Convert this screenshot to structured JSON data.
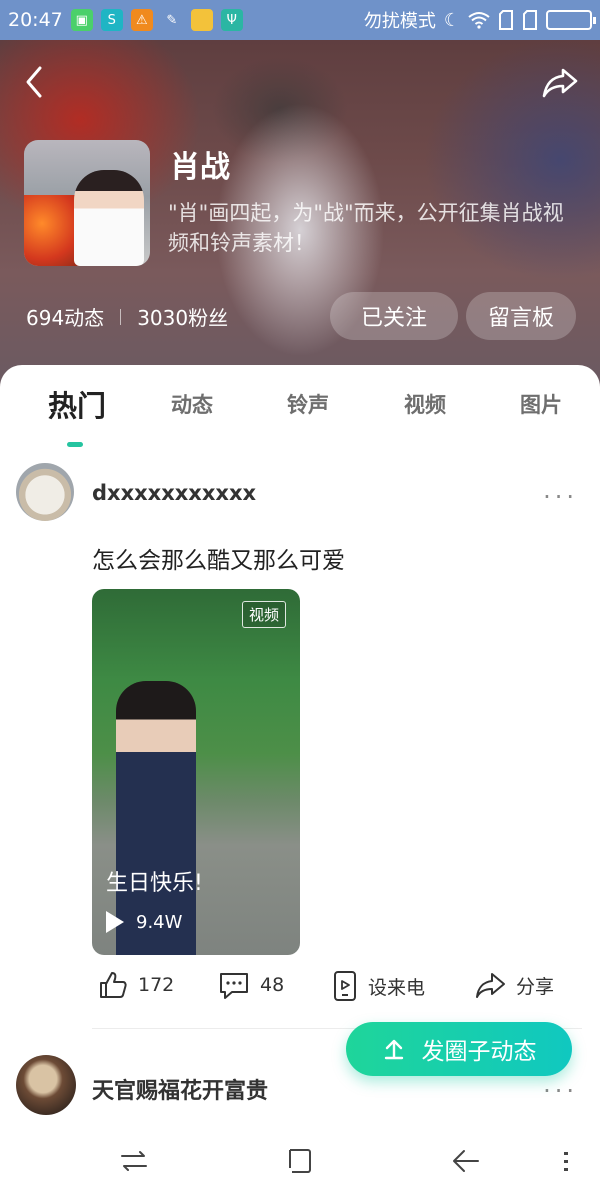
{
  "status_bar": {
    "time": "20:47",
    "dnd_label": "勿扰模式"
  },
  "profile": {
    "name": "肖战",
    "description": "\"肖\"画四起，为\"战\"而来，公开征集肖战视频和铃声素材！",
    "posts_count": "694动态",
    "fans_count": "3030粉丝",
    "follow_button": "已关注",
    "board_button": "留言板"
  },
  "tabs": [
    {
      "label": "热门",
      "active": true
    },
    {
      "label": "动态",
      "active": false
    },
    {
      "label": "铃声",
      "active": false
    },
    {
      "label": "视频",
      "active": false
    },
    {
      "label": "图片",
      "active": false
    }
  ],
  "post1": {
    "username": "dxxxxxxxxxxx",
    "text": "怎么会那么酷又那么可爱",
    "video": {
      "badge": "视频",
      "caption": "生日快乐!",
      "plays": "9.4W"
    },
    "actions": {
      "likes": "172",
      "comments": "48",
      "ringtone": "设来电",
      "share": "分享"
    }
  },
  "post2": {
    "username": "天官赐福花开富贵"
  },
  "fab": {
    "label": "发圈子动态"
  },
  "colors": {
    "accent": "#25c4a0",
    "status_bar": "#6f92c9",
    "fab_start": "#1fd59a",
    "fab_end": "#10c8c0"
  }
}
